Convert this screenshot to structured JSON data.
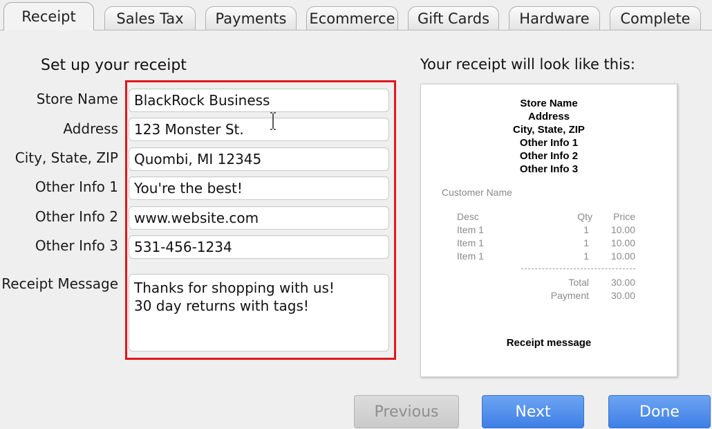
{
  "tabs": [
    {
      "label": "Receipt",
      "active": true
    },
    {
      "label": "Sales Tax",
      "active": false
    },
    {
      "label": "Payments",
      "active": false
    },
    {
      "label": "Ecommerce",
      "active": false
    },
    {
      "label": "Gift Cards",
      "active": false
    },
    {
      "label": "Hardware",
      "active": false
    },
    {
      "label": "Complete",
      "active": false
    }
  ],
  "form": {
    "title": "Set up your receipt",
    "fields": {
      "store_name": {
        "label": "Store Name",
        "value": "BlackRock Business"
      },
      "address": {
        "label": "Address",
        "value": "123 Monster St."
      },
      "city_state_zip": {
        "label": "City, State, ZIP",
        "value": "Quombi, MI 12345"
      },
      "other_info_1": {
        "label": "Other Info 1",
        "value": "You're the best!"
      },
      "other_info_2": {
        "label": "Other Info 2",
        "value": "www.website.com"
      },
      "other_info_3": {
        "label": "Other Info 3",
        "value": "531-456-1234"
      },
      "receipt_message": {
        "label": "Receipt Message",
        "value": "Thanks for shopping with us!\n30 day returns with tags!"
      }
    }
  },
  "preview": {
    "title": "Your receipt will look like this:",
    "header_lines": [
      "Store Name",
      "Address",
      "City, State, ZIP",
      "Other Info 1",
      "Other Info 2",
      "Other Info 3"
    ],
    "customer_label": "Customer Name",
    "columns": {
      "desc": "Desc",
      "qty": "Qty",
      "price": "Price"
    },
    "items": [
      {
        "desc": "Item 1",
        "qty": "1",
        "price": "10.00"
      },
      {
        "desc": "Item 1",
        "qty": "1",
        "price": "10.00"
      },
      {
        "desc": "Item 1",
        "qty": "1",
        "price": "10.00"
      }
    ],
    "total_label": "Total",
    "total_value": "30.00",
    "payment_label": "Payment",
    "payment_value": "30.00",
    "message": "Receipt message"
  },
  "buttons": {
    "previous": "Previous",
    "next": "Next",
    "done": "Done"
  },
  "colors": {
    "highlight": "#e0161c",
    "primary_button": "#4a88ea",
    "disabled_button": "#d2d2d2"
  }
}
